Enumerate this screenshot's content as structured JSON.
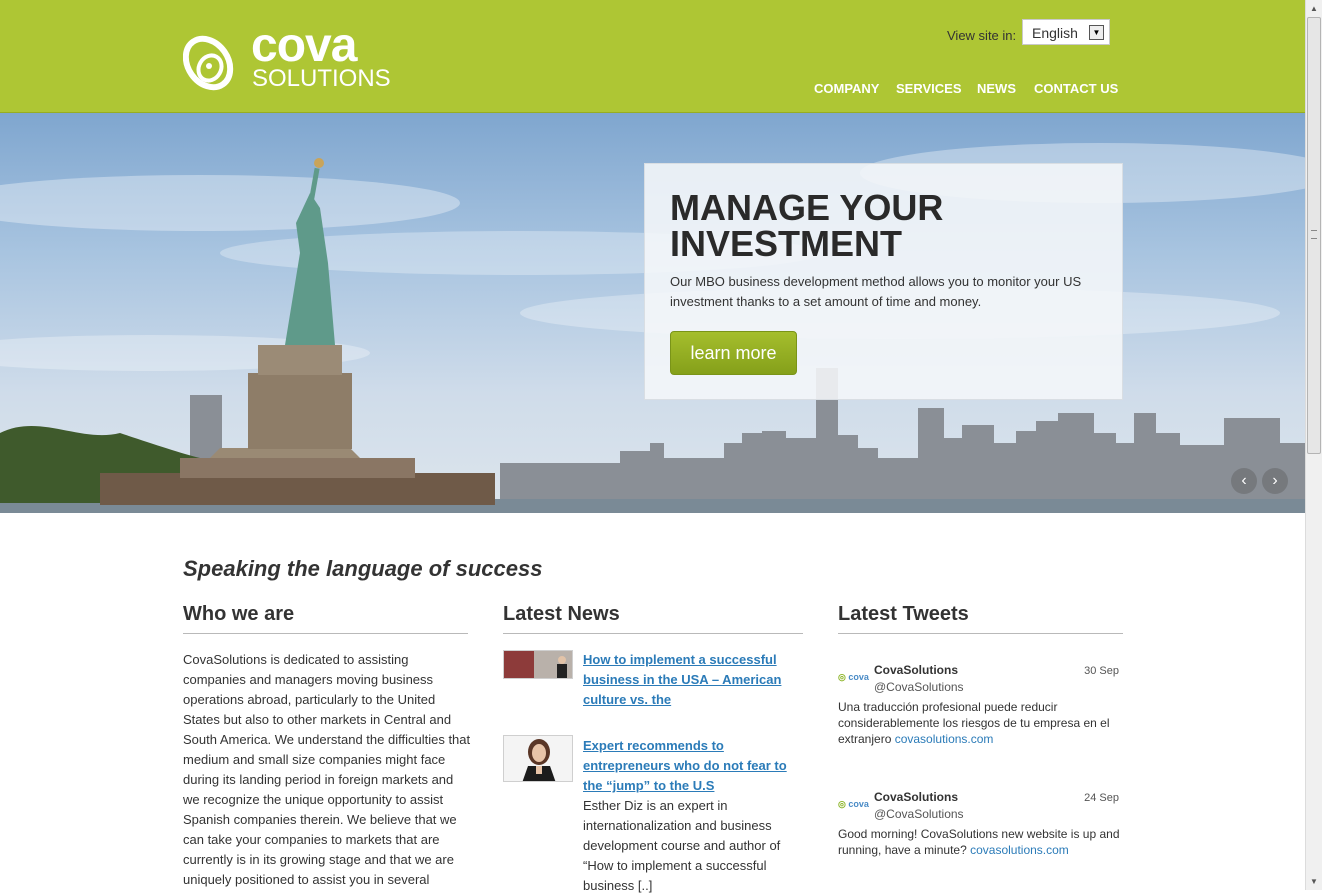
{
  "header": {
    "logo": {
      "word1": "cova",
      "word2": "SOLUTIONS"
    },
    "language": {
      "label": "View site in:",
      "selected": "English"
    },
    "nav": [
      {
        "label": "COMPANY"
      },
      {
        "label": "SERVICES"
      },
      {
        "label": "NEWS"
      },
      {
        "label": "CONTACT US"
      }
    ],
    "brand_color": "#aec634"
  },
  "hero": {
    "title": "MANAGE YOUR INVESTMENT",
    "text": "Our MBO business development method allows you to monitor your US investment thanks to a set amount of time and money.",
    "button": "learn more",
    "prev_icon": "chevron-left-icon",
    "next_icon": "chevron-right-icon"
  },
  "tagline": "Speaking the language of success",
  "who": {
    "title": "Who we are",
    "text": "CovaSolutions is dedicated to assisting companies and managers moving business operations abroad, particularly to the United States but also to other markets in Central and South America. We understand the difficulties that medium and small size companies might face during its landing period in foreign markets and we recognize the unique opportunity to assist Spanish companies therein. We believe that we can take your companies to markets that are currently is in its growing stage and that we are uniquely positioned to assist you in several"
  },
  "news": {
    "title": "Latest News",
    "items": [
      {
        "title": "How to implement a successful business in the USA – American culture vs. the",
        "excerpt": ""
      },
      {
        "title": "Expert recommends to entrepreneurs who do not fear to the “jump” to the U.S",
        "excerpt": "Esther Diz is an expert in internationalization and business development course and author of “How to implement a successful business [..]"
      }
    ]
  },
  "tweets": {
    "title": "Latest Tweets",
    "logo_text": "cova",
    "items": [
      {
        "name": "CovaSolutions",
        "handle": "@CovaSolutions",
        "date": "30 Sep",
        "text": "Una traducción profesional puede reducir considerablemente los riesgos de tu empresa en el extranjero ",
        "link": "covasolutions.com"
      },
      {
        "name": "CovaSolutions",
        "handle": "@CovaSolutions",
        "date": "24 Sep",
        "text": "Good morning! CovaSolutions new website is up and running, have a minute? ",
        "link": "covasolutions.com"
      }
    ]
  },
  "colors": {
    "link": "#2b7bb8",
    "button": "#8fa923",
    "text": "#333333"
  }
}
